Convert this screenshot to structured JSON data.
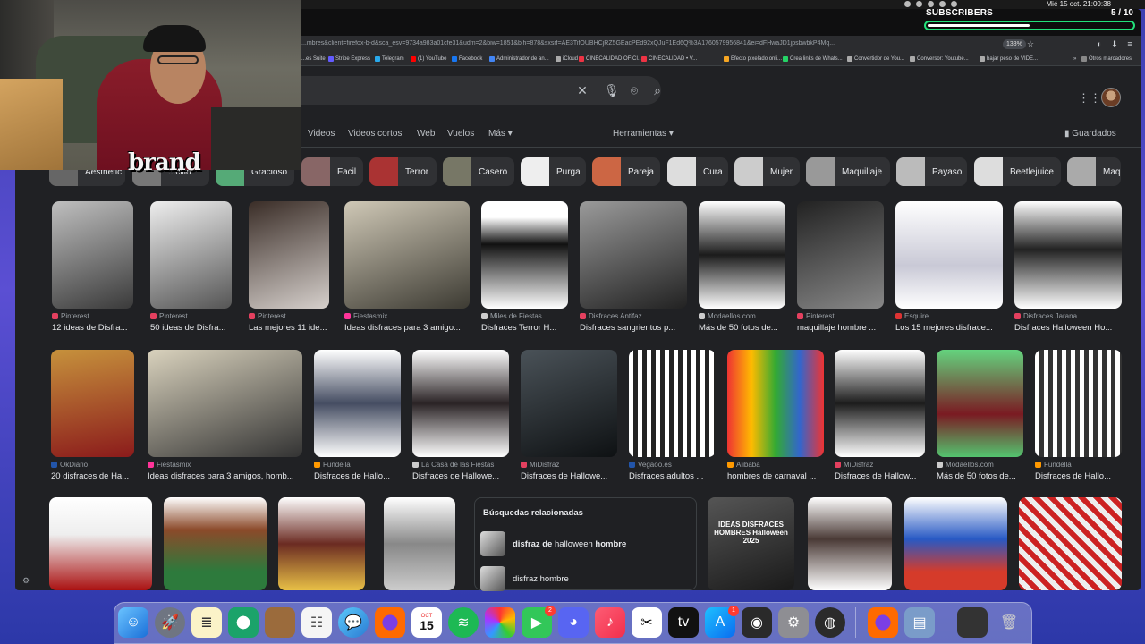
{
  "menubar": {
    "clock": "Mié 15 oct.  21:00:38"
  },
  "subscribers": {
    "label": "SUBSCRIBERS",
    "count": "5 / 10",
    "progress": 0.5
  },
  "browser": {
    "url": "...mbres&client=firefox-b-d&sca_esv=9734a983a01cfe31&udm=2&biw=1851&bih=878&sxsrf=AE3TifOUBHCjRZ5GEacPEd92xQJuF1Ed6Q%3A1760579956841&ei=dFHwaJD1jpsbwbkP4Mq...",
    "zoom": "133%",
    "bookmarks": [
      "...es Suite",
      "Stripe Express",
      "Telegram",
      "(1) YouTube",
      "Facebook",
      "Administrador de an...",
      "iCloud",
      "CINECALIDAD OFICI...",
      "CINECALIDAD • V...",
      "Efecto pixelado onli...",
      "Crea links de Whats...",
      "Convertidor de You...",
      "Conversor: Youtube...",
      "bajar peso de VIDE...",
      "Otros marcadores"
    ]
  },
  "nav": {
    "tabs": [
      "Videos",
      "Videos cortos",
      "Web",
      "Vuelos",
      "Más"
    ],
    "tools": "Herramientas",
    "saved": "Guardados"
  },
  "chips": [
    "Aesthetic",
    "...cillo",
    "Gracioso",
    "Facil",
    "Terror",
    "Casero",
    "Purga",
    "Pareja",
    "Cura",
    "Mujer",
    "Maquillaje",
    "Payaso",
    "Beetlejuice",
    "Maq"
  ],
  "row1": [
    {
      "source": "Pinterest",
      "title": "12 ideas de Disfra..."
    },
    {
      "source": "Pinterest",
      "title": "50 ideas de Disfra..."
    },
    {
      "source": "Pinterest",
      "title": "Las mejores 11 ide..."
    },
    {
      "source": "Fiestasmix",
      "title": "Ideas disfraces para 3 amigo..."
    },
    {
      "source": "Miles de Fiestas",
      "title": "Disfraces Terror H..."
    },
    {
      "source": "Disfraces Antifaz",
      "title": "Disfraces sangrientos p..."
    },
    {
      "source": "Modaellos.com",
      "title": "Más de 50 fotos de..."
    },
    {
      "source": "Pinterest",
      "title": "maquillaje hombre ..."
    },
    {
      "source": "Esquire",
      "title": "Los 15 mejores disfrace..."
    },
    {
      "source": "Disfraces Jarana",
      "title": "Disfraces Halloween Ho..."
    }
  ],
  "row2": [
    {
      "source": "OkDiario",
      "title": "20 disfraces de Ha..."
    },
    {
      "source": "Fiestasmix",
      "title": "Ideas disfraces para 3 amigos, homb..."
    },
    {
      "source": "Fundella",
      "title": "Disfraces de Hallo..."
    },
    {
      "source": "La Casa de las Fiestas",
      "title": "Disfraces de Hallowe..."
    },
    {
      "source": "MiDisfraz",
      "title": "Disfraces de Hallowe..."
    },
    {
      "source": "Vegaoo.es",
      "title": "Disfraces adultos ..."
    },
    {
      "source": "Alibaba",
      "title": "hombres de carnaval ..."
    },
    {
      "source": "MiDisfraz",
      "title": "Disfraces de Hallow..."
    },
    {
      "source": "Modaellos.com",
      "title": "Más de 50 fotos de..."
    },
    {
      "source": "Fundella",
      "title": "Disfraces de Hallo..."
    }
  ],
  "related": {
    "heading": "Búsquedas relacionadas",
    "items": [
      {
        "bold_prefix": "disfraz de ",
        "plain": "halloween",
        "bold_suffix": " hombre"
      },
      {
        "bold_prefix": "",
        "plain": "disfraz hombre",
        "bold_suffix": ""
      }
    ]
  },
  "row3_thumb_text": "IDEAS DISFRACES HOMBRES Halloween 2025",
  "webcam": {
    "logo_text": "brand"
  },
  "dock": {
    "calendar_month": "OCT",
    "calendar_day": "15",
    "facetime_badge": "2",
    "appstore_badge": "1"
  }
}
